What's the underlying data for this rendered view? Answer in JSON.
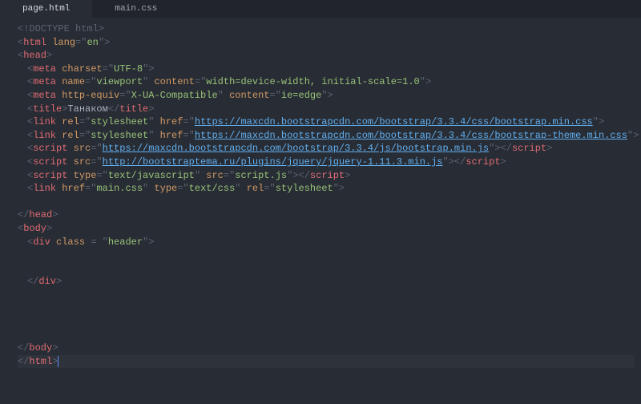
{
  "tabs": {
    "active": "page.html",
    "inactive": "main.css"
  },
  "code": {
    "doctype": {
      "open": "<!",
      "tag": "DOCTYPE",
      "rest": " html",
      "close": ">"
    },
    "html_open": {
      "lt": "<",
      "tag": "html",
      "attr": "lang",
      "eq": "=\"",
      "val": "en",
      "endq": "\"",
      "gt": ">"
    },
    "head_open": {
      "lt": "<",
      "tag": "head",
      "gt": ">"
    },
    "meta1": {
      "lt": "<",
      "tag": "meta",
      "a1": "charset",
      "eq1": "=\"",
      "v1": "UTF-8",
      "q1": "\"",
      "gt": ">"
    },
    "meta2": {
      "lt": "<",
      "tag": "meta",
      "a1": "name",
      "eq1": "=\"",
      "v1": "viewport",
      "q1": "\" ",
      "a2": "content",
      "eq2": "=\"",
      "v2": "width=device-width, initial-scale=1.0",
      "q2": "\"",
      "gt": ">"
    },
    "meta3": {
      "lt": "<",
      "tag": "meta",
      "a1": "http-equiv",
      "eq1": "=\"",
      "v1": "X-UA-Compatible",
      "q1": "\" ",
      "a2": "content",
      "eq2": "=\"",
      "v2": "ie=edge",
      "q2": "\"",
      "gt": ">"
    },
    "title": {
      "lt": "<",
      "tag": "title",
      "gt": ">",
      "text": "Танаком",
      "lt2": "</",
      "tag2": "title",
      "gt2": ">"
    },
    "link1": {
      "lt": "<",
      "tag": "link",
      "a1": "rel",
      "eq1": "=\"",
      "v1": "stylesheet",
      "q1": "\" ",
      "a2": "href",
      "eq2": "=\"",
      "url": "https://maxcdn.bootstrapcdn.com/bootstrap/3.3.4/css/bootstrap.min.css",
      "q2": "\"",
      "gt": ">"
    },
    "link2": {
      "lt": "<",
      "tag": "link",
      "a1": "rel",
      "eq1": "=\"",
      "v1": "stylesheet",
      "q1": "\" ",
      "a2": "href",
      "eq2": "=\"",
      "url": "https://maxcdn.bootstrapcdn.com/bootstrap/3.3.4/css/bootstrap-theme.min.css",
      "q2": "\"",
      "gt": ">"
    },
    "script1": {
      "lt": "<",
      "tag": "script",
      "a1": "src",
      "eq1": "=\"",
      "url": "https://maxcdn.bootstrapcdn.com/bootstrap/3.3.4/js/bootstrap.min.js",
      "q1": "\"",
      "gt": ">",
      "lt2": "</",
      "tag2": "script",
      "gt2": ">"
    },
    "script2": {
      "lt": "<",
      "tag": "script",
      "a1": "src",
      "eq1": "=\"",
      "url": "http://bootstraptema.ru/plugins/jquery/jquery-1.11.3.min.js",
      "q1": "\"",
      "gt": ">",
      "lt2": "</",
      "tag2": "script",
      "gt2": ">"
    },
    "script3": {
      "lt": "<",
      "tag": "script",
      "a1": "type",
      "eq1": "=\"",
      "v1": "text/javascript",
      "q1": "\" ",
      "a2": "src",
      "eq2": "=\"",
      "v2": "script.js",
      "q2": "\"",
      "gt": ">",
      "lt2": "</",
      "tag2": "script",
      "gt2": ">"
    },
    "link3": {
      "lt": "<",
      "tag": "link",
      "a1": "href",
      "eq1": "=\"",
      "v1": "main.css",
      "q1": "\" ",
      "a2": "type",
      "eq2": "=\"",
      "v2": "text/css",
      "q2": "\" ",
      "a3": "rel",
      "eq3": "=\"",
      "v3": "stylesheet",
      "q3": "\"",
      "gt": ">"
    },
    "head_close": {
      "lt": "</",
      "tag": "head",
      "gt": ">"
    },
    "body_open": {
      "lt": "<",
      "tag": "body",
      "gt": ">"
    },
    "div_open": {
      "lt": "<",
      "tag": "div",
      "a1": "class",
      "eq1": " = \"",
      "v1": "header",
      "q1": "\"",
      "gt": ">"
    },
    "div_close": {
      "lt": "</",
      "tag": "div",
      "gt": ">"
    },
    "body_close": {
      "lt": "</",
      "tag": "body",
      "gt": ">"
    },
    "html_close": {
      "lt": "</",
      "tag": "html",
      "gt": ">"
    }
  }
}
